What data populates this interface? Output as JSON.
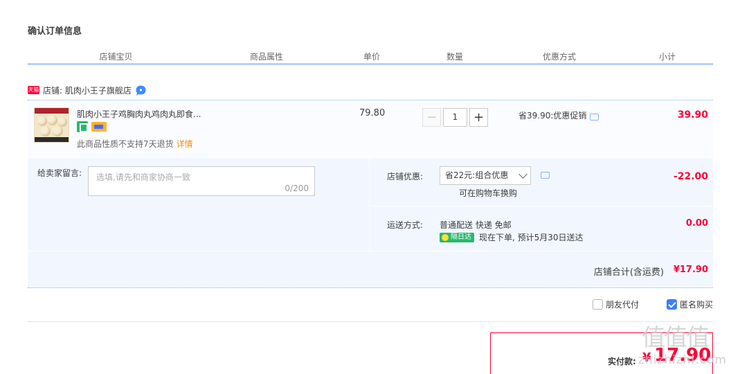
{
  "page": {
    "title": "确认订单信息"
  },
  "columns": [
    "店铺宝贝",
    "商品属性",
    "单价",
    "数量",
    "优惠方式",
    "小计"
  ],
  "shop": {
    "badge": "天猫",
    "label": "店铺: 肌肉小王子旗舰店"
  },
  "item": {
    "title": "肌肉小王子鸡胸肉丸鸡肉丸即食...",
    "no_return_text": "此商品性质不支持7天退货",
    "detail_link": "详情",
    "unit_price": "79.80",
    "quantity": "1",
    "promo": "省39.90:优惠促销",
    "subtotal": "39.90",
    "service_icons": [
      "shield-service-icon",
      "card-service-icon"
    ]
  },
  "message": {
    "label": "给卖家留言:",
    "placeholder": "选填,请先和商家协商一致",
    "count": "0/200"
  },
  "coupon": {
    "label": "店铺优惠:",
    "selected": "省22元:组合优惠",
    "note": "可在购物车换购",
    "amount": "-22.00"
  },
  "shipping": {
    "label": "运送方式:",
    "method": "普通配送 快递 免邮",
    "badge": "隔日达",
    "eta": "现在下单, 预计5月30日送达",
    "amount": "0.00"
  },
  "shop_total": {
    "label": "店铺合计(含运费)",
    "amount": "¥17.90"
  },
  "options": {
    "friend_pay": {
      "label": "朋友代付",
      "checked": false
    },
    "anonymous": {
      "label": "匿名购买",
      "checked": true
    }
  },
  "payment": {
    "label": "实付款:",
    "currency": "¥",
    "amount": "17.90"
  },
  "watermark": {
    "logo": "值值值",
    "url": "zhizhizhi.com"
  },
  "colors": {
    "price_red": "#ff0036",
    "accent_blue": "#3d7dff",
    "panel_blue": "#f2f7ff",
    "header_line": "#b2d1ff"
  }
}
